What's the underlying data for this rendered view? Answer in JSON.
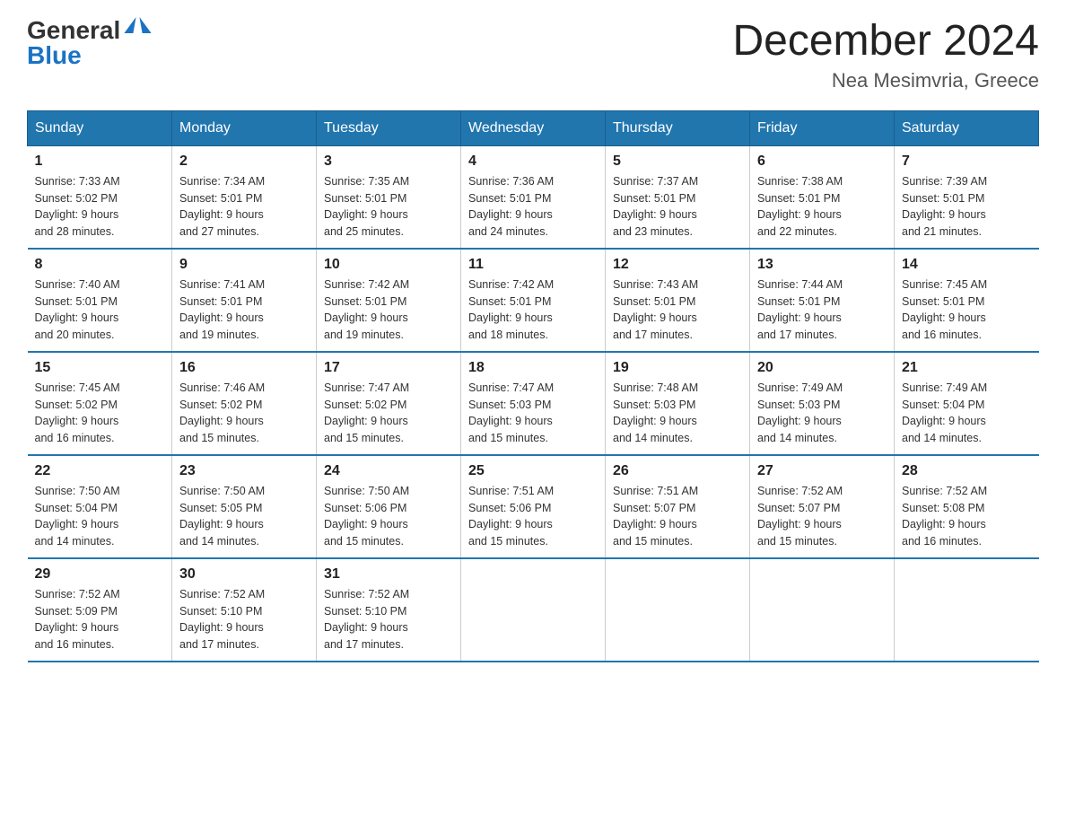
{
  "header": {
    "logo_general": "General",
    "logo_blue": "Blue",
    "month_title": "December 2024",
    "location": "Nea Mesimvria, Greece"
  },
  "days_of_week": [
    "Sunday",
    "Monday",
    "Tuesday",
    "Wednesday",
    "Thursday",
    "Friday",
    "Saturday"
  ],
  "weeks": [
    [
      {
        "day": "1",
        "sunrise": "7:33 AM",
        "sunset": "5:02 PM",
        "daylight": "9 hours and 28 minutes."
      },
      {
        "day": "2",
        "sunrise": "7:34 AM",
        "sunset": "5:01 PM",
        "daylight": "9 hours and 27 minutes."
      },
      {
        "day": "3",
        "sunrise": "7:35 AM",
        "sunset": "5:01 PM",
        "daylight": "9 hours and 25 minutes."
      },
      {
        "day": "4",
        "sunrise": "7:36 AM",
        "sunset": "5:01 PM",
        "daylight": "9 hours and 24 minutes."
      },
      {
        "day": "5",
        "sunrise": "7:37 AM",
        "sunset": "5:01 PM",
        "daylight": "9 hours and 23 minutes."
      },
      {
        "day": "6",
        "sunrise": "7:38 AM",
        "sunset": "5:01 PM",
        "daylight": "9 hours and 22 minutes."
      },
      {
        "day": "7",
        "sunrise": "7:39 AM",
        "sunset": "5:01 PM",
        "daylight": "9 hours and 21 minutes."
      }
    ],
    [
      {
        "day": "8",
        "sunrise": "7:40 AM",
        "sunset": "5:01 PM",
        "daylight": "9 hours and 20 minutes."
      },
      {
        "day": "9",
        "sunrise": "7:41 AM",
        "sunset": "5:01 PM",
        "daylight": "9 hours and 19 minutes."
      },
      {
        "day": "10",
        "sunrise": "7:42 AM",
        "sunset": "5:01 PM",
        "daylight": "9 hours and 19 minutes."
      },
      {
        "day": "11",
        "sunrise": "7:42 AM",
        "sunset": "5:01 PM",
        "daylight": "9 hours and 18 minutes."
      },
      {
        "day": "12",
        "sunrise": "7:43 AM",
        "sunset": "5:01 PM",
        "daylight": "9 hours and 17 minutes."
      },
      {
        "day": "13",
        "sunrise": "7:44 AM",
        "sunset": "5:01 PM",
        "daylight": "9 hours and 17 minutes."
      },
      {
        "day": "14",
        "sunrise": "7:45 AM",
        "sunset": "5:01 PM",
        "daylight": "9 hours and 16 minutes."
      }
    ],
    [
      {
        "day": "15",
        "sunrise": "7:45 AM",
        "sunset": "5:02 PM",
        "daylight": "9 hours and 16 minutes."
      },
      {
        "day": "16",
        "sunrise": "7:46 AM",
        "sunset": "5:02 PM",
        "daylight": "9 hours and 15 minutes."
      },
      {
        "day": "17",
        "sunrise": "7:47 AM",
        "sunset": "5:02 PM",
        "daylight": "9 hours and 15 minutes."
      },
      {
        "day": "18",
        "sunrise": "7:47 AM",
        "sunset": "5:03 PM",
        "daylight": "9 hours and 15 minutes."
      },
      {
        "day": "19",
        "sunrise": "7:48 AM",
        "sunset": "5:03 PM",
        "daylight": "9 hours and 14 minutes."
      },
      {
        "day": "20",
        "sunrise": "7:49 AM",
        "sunset": "5:03 PM",
        "daylight": "9 hours and 14 minutes."
      },
      {
        "day": "21",
        "sunrise": "7:49 AM",
        "sunset": "5:04 PM",
        "daylight": "9 hours and 14 minutes."
      }
    ],
    [
      {
        "day": "22",
        "sunrise": "7:50 AM",
        "sunset": "5:04 PM",
        "daylight": "9 hours and 14 minutes."
      },
      {
        "day": "23",
        "sunrise": "7:50 AM",
        "sunset": "5:05 PM",
        "daylight": "9 hours and 14 minutes."
      },
      {
        "day": "24",
        "sunrise": "7:50 AM",
        "sunset": "5:06 PM",
        "daylight": "9 hours and 15 minutes."
      },
      {
        "day": "25",
        "sunrise": "7:51 AM",
        "sunset": "5:06 PM",
        "daylight": "9 hours and 15 minutes."
      },
      {
        "day": "26",
        "sunrise": "7:51 AM",
        "sunset": "5:07 PM",
        "daylight": "9 hours and 15 minutes."
      },
      {
        "day": "27",
        "sunrise": "7:52 AM",
        "sunset": "5:07 PM",
        "daylight": "9 hours and 15 minutes."
      },
      {
        "day": "28",
        "sunrise": "7:52 AM",
        "sunset": "5:08 PM",
        "daylight": "9 hours and 16 minutes."
      }
    ],
    [
      {
        "day": "29",
        "sunrise": "7:52 AM",
        "sunset": "5:09 PM",
        "daylight": "9 hours and 16 minutes."
      },
      {
        "day": "30",
        "sunrise": "7:52 AM",
        "sunset": "5:10 PM",
        "daylight": "9 hours and 17 minutes."
      },
      {
        "day": "31",
        "sunrise": "7:52 AM",
        "sunset": "5:10 PM",
        "daylight": "9 hours and 17 minutes."
      },
      null,
      null,
      null,
      null
    ]
  ]
}
